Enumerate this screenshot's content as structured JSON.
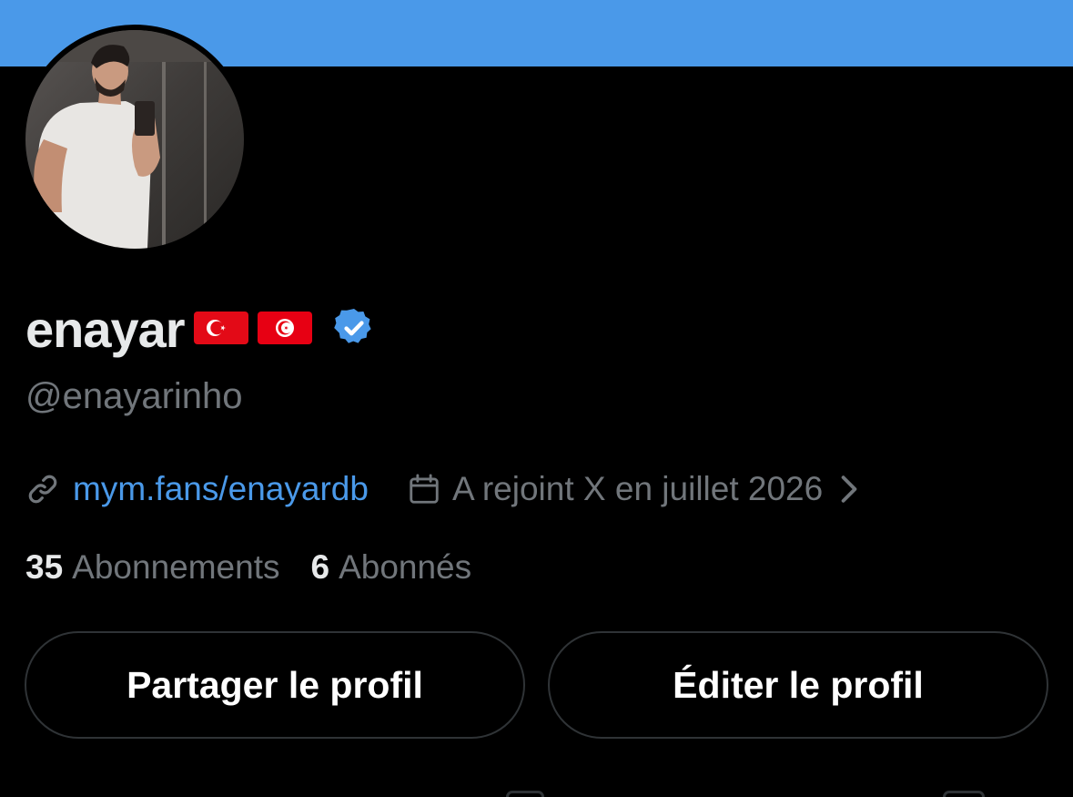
{
  "colors": {
    "banner": "#4a99e9",
    "background": "#000000",
    "link": "#4a99e9",
    "secondary_text": "#71767b",
    "primary_text": "#e7e9ea",
    "verified_badge": "#4a99e9",
    "button_border": "#2f3336"
  },
  "profile": {
    "display_name": "enayar",
    "flags": [
      "flag-turkey-icon",
      "flag-tunisia-icon"
    ],
    "verified_icon": "verified-badge-icon",
    "handle": "@enayarinho"
  },
  "meta": {
    "link_icon": "link-icon",
    "link_text": "mym.fans/enayardb",
    "joined_icon": "calendar-icon",
    "joined_text": "A rejoint X en juillet 2026",
    "chevron_icon": "chevron-right-icon"
  },
  "stats": {
    "following_count": "35",
    "following_label": "Abonnements",
    "followers_count": "6",
    "followers_label": "Abonnés"
  },
  "actions": {
    "share_label": "Partager le profil",
    "edit_label": "Éditer le profil"
  }
}
